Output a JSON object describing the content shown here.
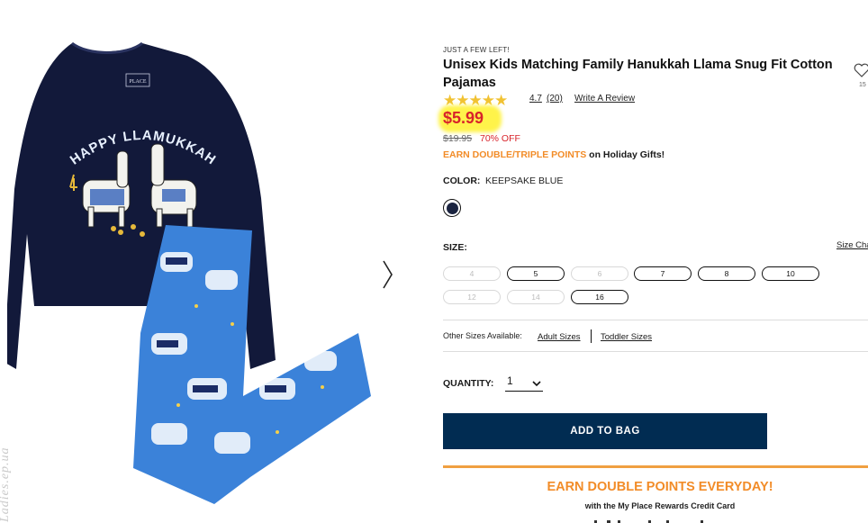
{
  "image_nav": {
    "next_arrow": "chevron-right-icon"
  },
  "watermark": "Ladies.ep.ua",
  "product": {
    "stock_note": "JUST A FEW LEFT!",
    "title": "Unisex Kids Matching Family Hanukkah Llama Snug Fit Cotton Pajamas",
    "rating": "4.7",
    "review_count": "(20)",
    "write_review": "Write A Review",
    "stars": "★★★★★",
    "wishlist_count": "15",
    "price": "$5.99",
    "old_price": "$19.95",
    "discount": "70% OFF",
    "promo_orange": "EARN DOUBLE/TRIPLE POINTS",
    "promo_rest": " on Holiday Gifts!",
    "color_label": "COLOR:",
    "color_value": "KEEPSAKE BLUE",
    "swatch_color": "#1b2440",
    "size_label": "SIZE:",
    "size_chart": "Size Chart",
    "sizes": [
      {
        "label": "4",
        "available": false
      },
      {
        "label": "5",
        "available": true
      },
      {
        "label": "6",
        "available": false
      },
      {
        "label": "7",
        "available": true
      },
      {
        "label": "8",
        "available": true
      },
      {
        "label": "10",
        "available": true
      },
      {
        "label": "12",
        "available": false
      },
      {
        "label": "14",
        "available": false
      },
      {
        "label": "16",
        "available": true
      }
    ],
    "other_sizes_label": "Other Sizes Available:",
    "adult_sizes": "Adult Sizes",
    "toddler_sizes": "Toddler Sizes",
    "quantity_label": "QUANTITY:",
    "quantity_value": "1",
    "add_to_bag": "ADD TO BAG"
  },
  "rewards": {
    "headline": "EARN DOUBLE POINTS EVERYDAY!",
    "sub": "with the My Place Rewards Credit Card"
  },
  "image_text": {
    "shirt_print": "HAPPY LLAMUKKAH",
    "tag": "PLACE"
  },
  "colors": {
    "price_red": "#d8232a",
    "accent_orange": "#f28c28",
    "button_navy": "#012c52",
    "highlight": "#fff34a"
  }
}
